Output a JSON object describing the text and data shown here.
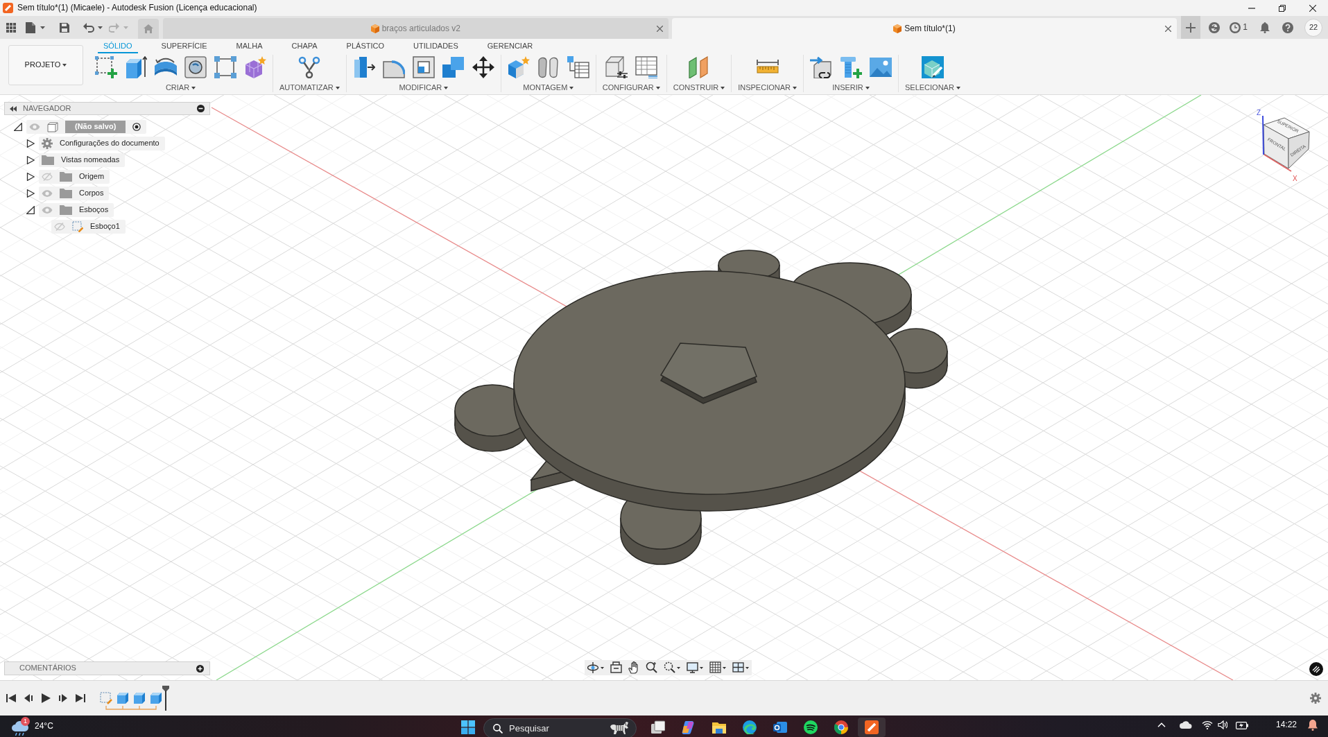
{
  "window": {
    "title": "Sem título*(1) (Micaele) - Autodesk Fusion (Licença educacional)"
  },
  "history": {
    "undo": {
      "disabled": false
    },
    "redo": {
      "disabled": true
    }
  },
  "document_tabs": [
    {
      "label": "braços articulados v2",
      "selected": false
    },
    {
      "label": "Sem título*(1)",
      "selected": true
    }
  ],
  "account": {
    "jobs": "1",
    "avatar": "22"
  },
  "toolbar": {
    "project_button": "PROJETO",
    "tabs": [
      {
        "label": "SÓLIDO",
        "selected": true
      },
      {
        "label": "SUPERFÍCIE",
        "selected": false
      },
      {
        "label": "MALHA",
        "selected": false
      },
      {
        "label": "CHAPA",
        "selected": false
      },
      {
        "label": "PLÁSTICO",
        "selected": false
      },
      {
        "label": "UTILIDADES",
        "selected": false
      },
      {
        "label": "GERENCIAR",
        "selected": false
      }
    ],
    "groups": [
      {
        "kind": "create",
        "label": "CRIAR"
      },
      {
        "kind": "automate",
        "label": "AUTOMATIZAR"
      },
      {
        "kind": "modify",
        "label": "MODIFICAR"
      },
      {
        "kind": "assemble",
        "label": "MONTAGEM"
      },
      {
        "kind": "configure",
        "label": "CONFIGURAR"
      },
      {
        "kind": "construct",
        "label": "CONSTRUIR"
      },
      {
        "kind": "inspect",
        "label": "INSPECIONAR"
      },
      {
        "kind": "insert",
        "label": "INSERIR"
      },
      {
        "kind": "select",
        "label": "SELECIONAR"
      }
    ]
  },
  "navigator": {
    "title": "NAVEGADOR",
    "tree": [
      {
        "kind": "component",
        "label": "(Não salvo)",
        "visible": true,
        "expanded": true,
        "active": true,
        "children": [
          {
            "kind": "settings",
            "label": "Configurações do documento",
            "expanded": false
          },
          {
            "kind": "folder",
            "label": "Vistas nomeadas",
            "expanded": false
          },
          {
            "kind": "folder",
            "label": "Origem",
            "visible": false,
            "expanded": false
          },
          {
            "kind": "folder",
            "label": "Corpos",
            "visible": true,
            "expanded": false
          },
          {
            "kind": "folder",
            "label": "Esboços",
            "visible": true,
            "expanded": true,
            "children": [
              {
                "kind": "sketch",
                "label": "Esboço1",
                "visible": false
              }
            ]
          }
        ]
      }
    ]
  },
  "view_cube": {
    "faces": [
      "SUPERIOR",
      "FRONTAL",
      "DIREITA"
    ],
    "axes": [
      "Z",
      "X"
    ]
  },
  "comments": {
    "title": "COMENTÁRIOS"
  },
  "timeline": {
    "features": [
      {
        "kind": "sketch"
      },
      {
        "kind": "extrude"
      },
      {
        "kind": "extrude"
      },
      {
        "kind": "extrude"
      }
    ]
  },
  "taskbar": {
    "weather": {
      "badge": "1",
      "temperature": "24°C"
    },
    "search": {
      "placeholder": "Pesquisar"
    },
    "apps": [
      {
        "kind": "task_view",
        "selected": false
      },
      {
        "kind": "copilot",
        "selected": false
      },
      {
        "kind": "file_explorer",
        "selected": false
      },
      {
        "kind": "edge",
        "selected": false
      },
      {
        "kind": "outlook",
        "selected": false
      },
      {
        "kind": "spotify",
        "selected": false
      },
      {
        "kind": "chrome",
        "selected": false
      },
      {
        "kind": "fusion",
        "selected": true
      }
    ],
    "clock": "14:22"
  }
}
